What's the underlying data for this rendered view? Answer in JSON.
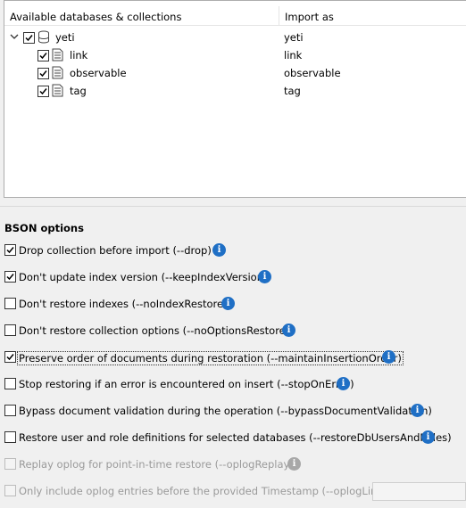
{
  "table": {
    "col_available": "Available databases & collections",
    "col_import_as": "Import as",
    "database": {
      "name": "yeti",
      "import_as": "yeti"
    },
    "collections": [
      {
        "name": "link",
        "import_as": "link"
      },
      {
        "name": "observable",
        "import_as": "observable"
      },
      {
        "name": "tag",
        "import_as": "tag"
      }
    ]
  },
  "bson": {
    "title": "BSON options",
    "options": [
      {
        "label": "Drop collection before import (--drop)",
        "checked": true
      },
      {
        "label": "Don't update index version (--keepIndexVersion)",
        "checked": true
      },
      {
        "label": "Don't restore indexes (--noIndexRestore)",
        "checked": false
      },
      {
        "label": "Don't restore collection options (--noOptionsRestore)",
        "checked": false
      },
      {
        "label": "Preserve order of documents during restoration (--maintainInsertionOrder)",
        "checked": true
      },
      {
        "label": "Stop restoring if an error is encountered on insert (--stopOnError)",
        "checked": false
      },
      {
        "label": "Bypass document validation during the operation (--bypassDocumentValidation)",
        "checked": false
      },
      {
        "label": "Restore user and role definitions for selected databases (--restoreDbUsersAndRoles)",
        "checked": false
      },
      {
        "label": "Replay oplog for point-in-time restore (--oplogReplay)",
        "checked": false,
        "disabled": true
      },
      {
        "label": "Only include oplog entries before the provided Timestamp (--oplogLimit)",
        "checked": false,
        "disabled": true
      }
    ],
    "info_glyph": "i"
  },
  "colors": {
    "info": "#1f6fc5",
    "info_disabled": "#a8a8a8"
  }
}
